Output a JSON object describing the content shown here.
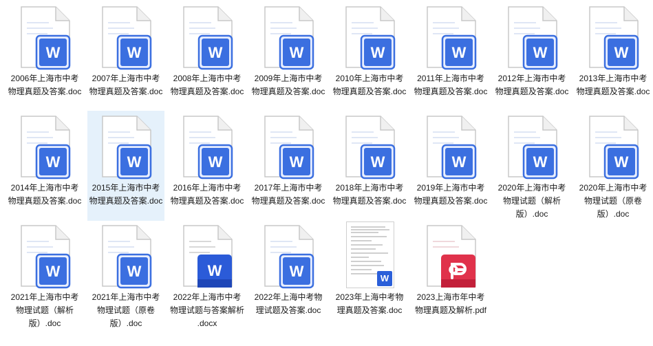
{
  "files": [
    {
      "name": "2006年上海市中考物理真题及答案.doc",
      "icon": "word-doc-icon",
      "selected": false
    },
    {
      "name": "2007年上海市中考物理真题及答案.doc",
      "icon": "word-doc-icon",
      "selected": false
    },
    {
      "name": "2008年上海市中考物理真题及答案.doc",
      "icon": "word-doc-icon",
      "selected": false
    },
    {
      "name": "2009年上海市中考物理真题及答案.doc",
      "icon": "word-doc-icon",
      "selected": false
    },
    {
      "name": "2010年上海市中考物理真题及答案.doc",
      "icon": "word-doc-icon",
      "selected": false
    },
    {
      "name": "2011年上海市中考物理真题及答案.doc",
      "icon": "word-doc-icon",
      "selected": false
    },
    {
      "name": "2012年上海市中考物理真题及答案.doc",
      "icon": "word-doc-icon",
      "selected": false
    },
    {
      "name": "2013年上海市中考物理真题及答案.doc",
      "icon": "word-doc-icon",
      "selected": false
    },
    {
      "name": "2014年上海市中考物理真题及答案.doc",
      "icon": "word-doc-icon",
      "selected": false
    },
    {
      "name": "2015年上海市中考物理真题及答案.doc",
      "icon": "word-doc-icon",
      "selected": true
    },
    {
      "name": "2016年上海市中考物理真题及答案.doc",
      "icon": "word-doc-icon",
      "selected": false
    },
    {
      "name": "2017年上海市中考物理真题及答案.doc",
      "icon": "word-doc-icon",
      "selected": false
    },
    {
      "name": "2018年上海市中考物理真题及答案.doc",
      "icon": "word-doc-icon",
      "selected": false
    },
    {
      "name": "2019年上海市中考物理真题及答案.doc",
      "icon": "word-doc-icon",
      "selected": false
    },
    {
      "name": "2020年上海市中考物理试题（解析版）.doc",
      "icon": "word-doc-icon",
      "selected": false
    },
    {
      "name": "2020年上海市中考物理试题（原卷版）.doc",
      "icon": "word-doc-icon",
      "selected": false
    },
    {
      "name": "2021年上海市中考物理试题（解析版）.doc",
      "icon": "word-doc-icon",
      "selected": false
    },
    {
      "name": "2021年上海市中考物理试题（原卷版）.doc",
      "icon": "word-doc-icon",
      "selected": false
    },
    {
      "name": "2022年上海市中考物理试题与答案解析 .docx",
      "icon": "word-docx-icon",
      "selected": false
    },
    {
      "name": "2022年上海中考物理试题及答案.doc",
      "icon": "word-doc-icon",
      "selected": false
    },
    {
      "name": "2023年上海中考物理真题及答案.doc",
      "icon": "doc-preview-thumbnail",
      "selected": false
    },
    {
      "name": "2023上海市年中考物理真题及解析.pdf",
      "icon": "pdf-icon",
      "selected": false
    }
  ],
  "colors": {
    "word": "#3b6fe0",
    "docx": "#2b5bd8",
    "pdf": "#e0324b",
    "selected": "#e5f1fb"
  },
  "icon_letters": {
    "word": "W"
  }
}
